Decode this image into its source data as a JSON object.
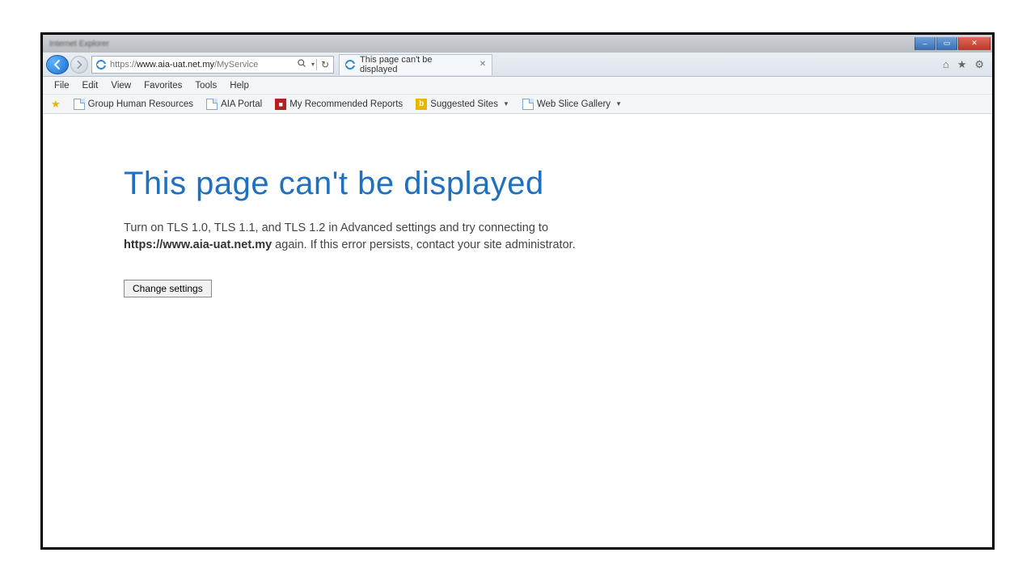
{
  "window": {
    "title_blur": "Internet Explorer",
    "min": "–",
    "max": "▭",
    "close": "✕"
  },
  "address": {
    "scheme": "https://",
    "host": "www.aia-uat.net.my",
    "path": "/MyService",
    "search_glyph": "🔍",
    "refresh_glyph": "↻"
  },
  "tab": {
    "title": "This page can't be displayed"
  },
  "chrome_icons": {
    "home": "⌂",
    "star": "★",
    "gear": "⚙"
  },
  "menu": {
    "file": "File",
    "edit": "Edit",
    "view": "View",
    "favorites": "Favorites",
    "tools": "Tools",
    "help": "Help"
  },
  "favorites": {
    "ghr": "Group Human Resources",
    "aia_portal": "AIA Portal",
    "recommended": "My Recommended Reports",
    "suggested": "Suggested Sites",
    "webslice": "Web Slice Gallery"
  },
  "error": {
    "heading": "This page can't be displayed",
    "body_prefix": "Turn on TLS 1.0, TLS 1.1, and TLS 1.2 in Advanced settings and try connecting to ",
    "body_host": "https://www.aia-uat.net.my",
    "body_suffix": " again. If this error persists, contact your site administrator.",
    "button": "Change settings"
  }
}
